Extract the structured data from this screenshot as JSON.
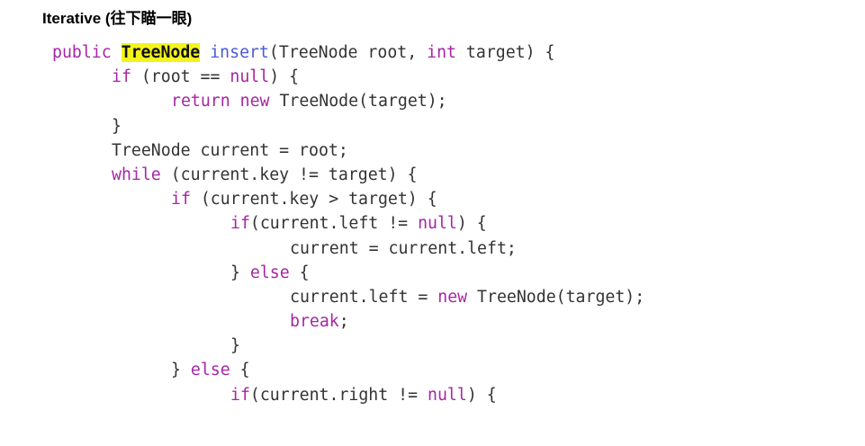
{
  "heading": "Iterative (往下瞄一眼)",
  "colors": {
    "keyword": "#a626a4",
    "function": "#4c5bd6",
    "text": "#333333",
    "highlight": "#f4f41c"
  },
  "code_lines": [
    {
      "indent": 0,
      "tokens": [
        {
          "t": "public ",
          "k": "kw"
        },
        {
          "t": "TreeNode",
          "k": "hl"
        },
        {
          "t": " "
        },
        {
          "t": "insert",
          "k": "fn"
        },
        {
          "t": "(TreeNode root, "
        },
        {
          "t": "int",
          "k": "kw"
        },
        {
          "t": " target) {"
        }
      ]
    },
    {
      "indent": 1,
      "tokens": [
        {
          "t": "if",
          "k": "kw"
        },
        {
          "t": " (root == "
        },
        {
          "t": "null",
          "k": "kw"
        },
        {
          "t": ") {"
        }
      ]
    },
    {
      "indent": 2,
      "tokens": [
        {
          "t": "return",
          "k": "kw"
        },
        {
          "t": " "
        },
        {
          "t": "new",
          "k": "kw"
        },
        {
          "t": " TreeNode(target);"
        }
      ]
    },
    {
      "indent": 1,
      "tokens": [
        {
          "t": "}"
        }
      ]
    },
    {
      "indent": 1,
      "tokens": [
        {
          "t": "TreeNode current = root;"
        }
      ]
    },
    {
      "indent": 1,
      "tokens": [
        {
          "t": "while",
          "k": "kw"
        },
        {
          "t": " (current.key != target) {"
        }
      ]
    },
    {
      "indent": 2,
      "tokens": [
        {
          "t": "if",
          "k": "kw"
        },
        {
          "t": " (current.key > target) {"
        }
      ]
    },
    {
      "indent": 3,
      "tokens": [
        {
          "t": "if",
          "k": "kw"
        },
        {
          "t": "(current.left != "
        },
        {
          "t": "null",
          "k": "kw"
        },
        {
          "t": ") {"
        }
      ]
    },
    {
      "indent": 4,
      "tokens": [
        {
          "t": "current = current.left;"
        }
      ]
    },
    {
      "indent": 3,
      "tokens": [
        {
          "t": "} "
        },
        {
          "t": "else",
          "k": "kw"
        },
        {
          "t": " {"
        }
      ]
    },
    {
      "indent": 4,
      "tokens": [
        {
          "t": "current.left = "
        },
        {
          "t": "new",
          "k": "kw"
        },
        {
          "t": " TreeNode(target);"
        }
      ]
    },
    {
      "indent": 4,
      "tokens": [
        {
          "t": "break",
          "k": "kw"
        },
        {
          "t": ";"
        }
      ]
    },
    {
      "indent": 3,
      "tokens": [
        {
          "t": "}"
        }
      ]
    },
    {
      "indent": 2,
      "tokens": [
        {
          "t": "} "
        },
        {
          "t": "else",
          "k": "kw"
        },
        {
          "t": " {"
        }
      ]
    },
    {
      "indent": 3,
      "tokens": [
        {
          "t": "if",
          "k": "kw"
        },
        {
          "t": "(current.right != "
        },
        {
          "t": "null",
          "k": "kw"
        },
        {
          "t": ") {"
        }
      ]
    }
  ]
}
